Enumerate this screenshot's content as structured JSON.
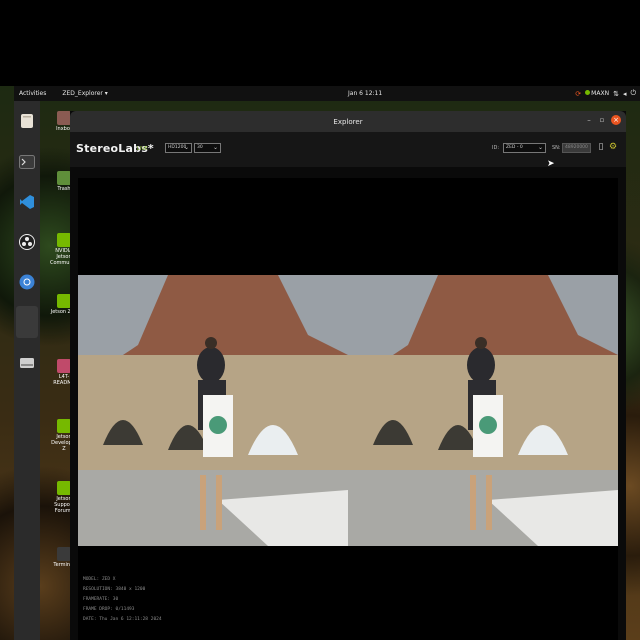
{
  "topbar": {
    "activities": "Activities",
    "app_menu": "ZED_Explorer ▾",
    "clock": "Jan 6 12:11",
    "power_mode": "MAXN"
  },
  "desktop_icons": [
    {
      "label": "lnxbot"
    },
    {
      "label": "Trash"
    },
    {
      "label": "NVIDIA Jetson Community"
    },
    {
      "label": "Jetson Zoo"
    },
    {
      "label": "L4T-README"
    },
    {
      "label": "Jetson Developer Z"
    },
    {
      "label": "Jetson Support Forums"
    },
    {
      "label": "Terminal"
    }
  ],
  "dock": {
    "items": [
      "files-icon",
      "terminal-icon",
      "vscode-icon",
      "obs-icon",
      "chromium-icon",
      "blank-app-icon",
      "drive-icon"
    ]
  },
  "window": {
    "title": "Explorer"
  },
  "toolbar": {
    "brand": "StereoLabs*",
    "live_label": "LIVE",
    "resolution": "HD1200",
    "fps": "30",
    "id_label": "ID:",
    "camera_select": "ZED  -  0",
    "sn_label": "SN:",
    "sn_value": "48920000"
  },
  "info": {
    "model": "MODEL: ZED X",
    "resolution": "RESOLUTION: 3840 x 1200",
    "framerate": "FRAMERATE: 30",
    "frame_drop": "FRAME DROP: 0/11493",
    "date": "DATE: Thu Jan 6 12:11:28 2024"
  },
  "colors": {
    "accent_orange": "#e95420",
    "nvidia_green": "#76b900",
    "live_green": "#8fbf3a"
  }
}
